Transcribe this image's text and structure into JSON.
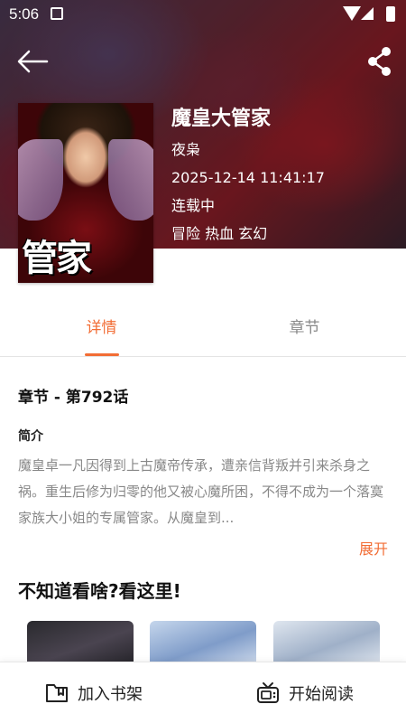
{
  "status_bar": {
    "time": "5:06"
  },
  "book": {
    "title": "魔皇大管家",
    "author": "夜枭",
    "updated": "2025-12-14 11:41:17",
    "status": "连载中",
    "tags": "冒险 热血 玄幻",
    "cover_text": "管家"
  },
  "tabs": [
    {
      "label": "详情",
      "active": true
    },
    {
      "label": "章节",
      "active": false
    }
  ],
  "details": {
    "latest_chapter": "章节 - 第792话",
    "intro_label": "简介",
    "intro": "魔皇卓一凡因得到上古魔帝传承，遭亲信背叛并引来杀身之祸。重生后修为归零的他又被心魔所困，不得不成为一个落寞家族大小姐的专属管家。从魔皇到...",
    "expand_label": "展开"
  },
  "recommend": {
    "title": "不知道看啥?看这里!"
  },
  "bottom_bar": {
    "add_shelf_label": "加入书架",
    "start_read_label": "开始阅读"
  },
  "colors": {
    "accent": "#f26d35"
  },
  "icons": [
    "back-arrow-icon",
    "share-icon",
    "bookshelf-icon",
    "tv-read-icon"
  ]
}
